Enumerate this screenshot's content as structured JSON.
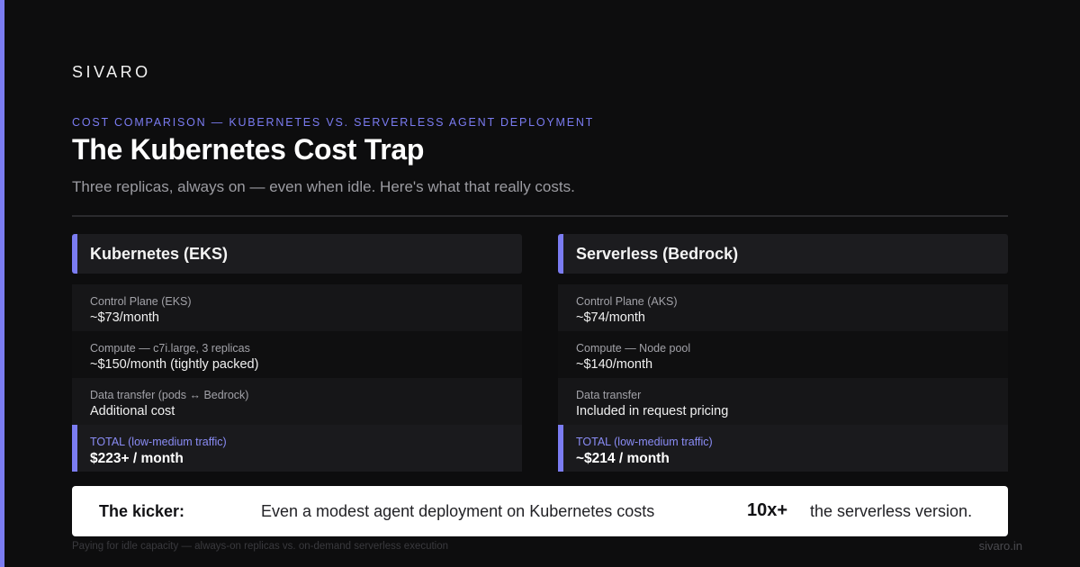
{
  "brand": "SIVARO",
  "eyebrow": "COST COMPARISON — KUBERNETES VS. SERVERLESS AGENT DEPLOYMENT",
  "title": "The Kubernetes Cost Trap",
  "subtitle": "Three replicas, always on — even when idle. Here's what that really costs.",
  "accent_color": "#7b7cf2",
  "left": {
    "header": "Kubernetes (EKS)",
    "rows": [
      {
        "label": "Control Plane (EKS)",
        "value": "~$73/month"
      },
      {
        "label": "Compute — c7i.large, 3 replicas",
        "value": "~$150/month (tightly packed)"
      },
      {
        "label": "Data transfer (pods ↔ Bedrock)",
        "value": "Additional cost"
      }
    ],
    "total": {
      "label": "TOTAL (low-medium traffic)",
      "value": "$223+ / month"
    }
  },
  "right": {
    "header": "Serverless (Bedrock)",
    "rows": [
      {
        "label": "Control Plane (AKS)",
        "value": "~$74/month"
      },
      {
        "label": "Compute — Node pool",
        "value": "~$140/month"
      },
      {
        "label": "Data transfer",
        "value": "Included in request pricing"
      }
    ],
    "total": {
      "label": "TOTAL (low-medium traffic)",
      "value": "~$214 / month"
    }
  },
  "kicker": {
    "label": "The kicker:",
    "text": "Even a modest agent deployment on Kubernetes costs",
    "multiplier": "10x+",
    "tail": "the serverless version."
  },
  "footer": {
    "note": "Paying for idle capacity — always-on replicas vs. on-demand serverless execution",
    "url": "sivaro.in"
  }
}
